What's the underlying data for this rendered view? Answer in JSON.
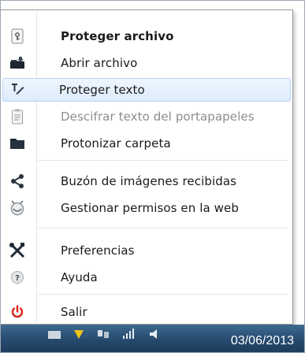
{
  "menu": {
    "items": [
      {
        "label": "Proteger archivo",
        "icon": "protect-file-icon",
        "style": "bold"
      },
      {
        "label": "Abrir archivo",
        "icon": "open-file-icon",
        "style": "normal"
      },
      {
        "label": "Proteger texto",
        "icon": "protect-text-icon",
        "style": "hover"
      },
      {
        "label": "Descifrar texto del portapapeles",
        "icon": "clipboard-decrypt-icon",
        "style": "disabled"
      },
      {
        "label": "Protonizar carpeta",
        "icon": "folder-icon",
        "style": "normal"
      },
      {
        "label": "Buzón de imágenes recibidas",
        "icon": "share-icon",
        "style": "normal"
      },
      {
        "label": "Gestionar permisos en la web",
        "icon": "web-permissions-icon",
        "style": "normal"
      },
      {
        "label": "Preferencias",
        "icon": "tools-icon",
        "style": "normal"
      },
      {
        "label": "Ayuda",
        "icon": "help-icon",
        "style": "normal"
      },
      {
        "label": "Salir",
        "icon": "power-icon",
        "style": "normal"
      }
    ]
  },
  "taskbar": {
    "clock": "03/06/2013"
  },
  "colors": {
    "hover_bg": "#dcebfc",
    "hover_border": "#b8d6fb",
    "disabled_text": "#8d8d8d",
    "power_red": "#d9251c",
    "taskbar": "#24476a"
  }
}
